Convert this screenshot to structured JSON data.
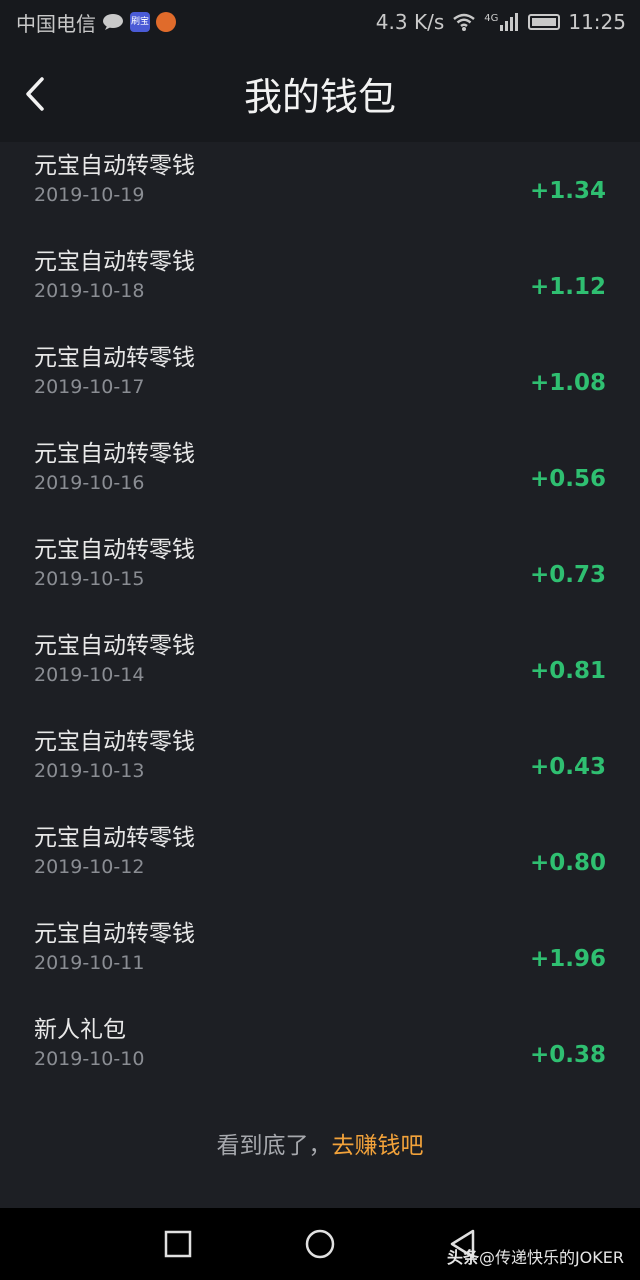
{
  "status_bar": {
    "carrier": "中国电信",
    "app_icon_1_text": "刷宝",
    "network_speed": "4.3 K/s",
    "network_type": "4G",
    "time": "11:25"
  },
  "header": {
    "title": "我的钱包"
  },
  "transactions": [
    {
      "name": "元宝自动转零钱",
      "date": "2019-10-19",
      "amount": "+1.34"
    },
    {
      "name": "元宝自动转零钱",
      "date": "2019-10-18",
      "amount": "+1.12"
    },
    {
      "name": "元宝自动转零钱",
      "date": "2019-10-17",
      "amount": "+1.08"
    },
    {
      "name": "元宝自动转零钱",
      "date": "2019-10-16",
      "amount": "+0.56"
    },
    {
      "name": "元宝自动转零钱",
      "date": "2019-10-15",
      "amount": "+0.73"
    },
    {
      "name": "元宝自动转零钱",
      "date": "2019-10-14",
      "amount": "+0.81"
    },
    {
      "name": "元宝自动转零钱",
      "date": "2019-10-13",
      "amount": "+0.43"
    },
    {
      "name": "元宝自动转零钱",
      "date": "2019-10-12",
      "amount": "+0.80"
    },
    {
      "name": "元宝自动转零钱",
      "date": "2019-10-11",
      "amount": "+1.96"
    },
    {
      "name": "新人礼包",
      "date": "2019-10-10",
      "amount": "+0.38"
    }
  ],
  "footer": {
    "end_text": "看到底了，",
    "earn_link": "去赚钱吧"
  },
  "watermark": {
    "brand": "头条",
    "handle": "@传递快乐的JOKER"
  },
  "colors": {
    "amount": "#2fbf71",
    "link": "#f2a23a",
    "background": "#1d1f24"
  }
}
